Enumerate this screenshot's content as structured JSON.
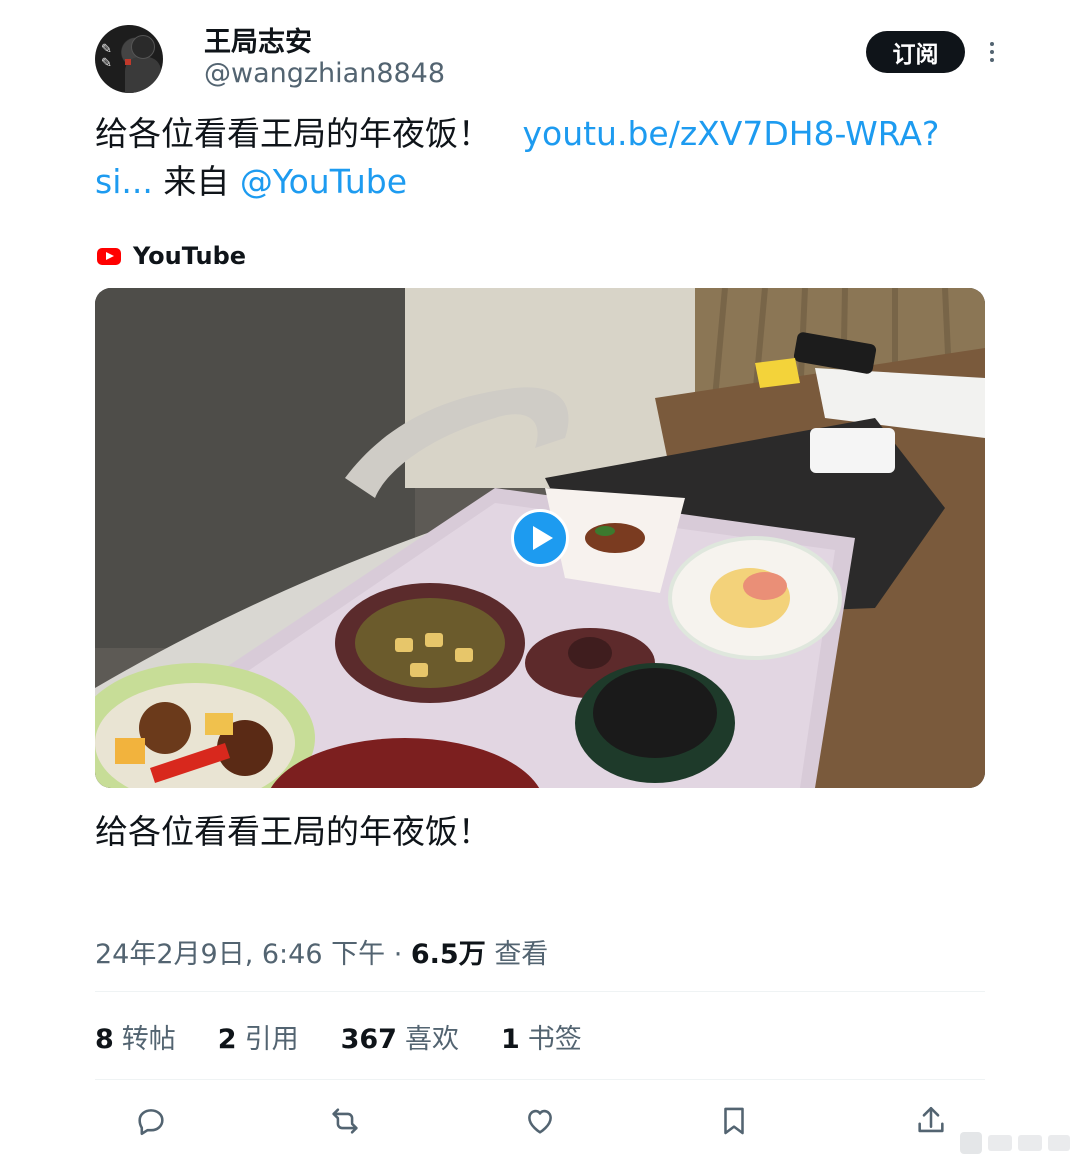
{
  "author": {
    "display_name": "王局志安",
    "handle": "@wangzhian8848",
    "avatar_icon": "avatar-calligraphy-portrait"
  },
  "header": {
    "subscribe_label": "订阅",
    "more_icon": "more-vertical-icon"
  },
  "tweet": {
    "text_plain": "给各位看看王局的年夜饭！",
    "link_1": "youtu.be/zXV7DH8-WRA?si...",
    "from_label": "来自",
    "mention": "@YouTube"
  },
  "card": {
    "source_name": "YouTube",
    "source_icon": "youtube-logo-icon",
    "title": "给各位看看王局的年夜饭！",
    "play_icon": "play-icon"
  },
  "meta": {
    "timestamp": "24年2月9日, 6:46 下午",
    "separator": "·",
    "views_count": "6.5万",
    "views_label": "查看"
  },
  "stats": [
    {
      "count": "8",
      "label": "转帖"
    },
    {
      "count": "2",
      "label": "引用"
    },
    {
      "count": "367",
      "label": "喜欢"
    },
    {
      "count": "1",
      "label": "书签"
    }
  ],
  "actions": [
    "reply-icon",
    "retweet-icon",
    "like-icon",
    "bookmark-icon",
    "share-icon"
  ],
  "colors": {
    "link": "#1d9bf0",
    "text": "#0f1419",
    "secondary": "#536471",
    "button_bg": "#0f1419"
  }
}
